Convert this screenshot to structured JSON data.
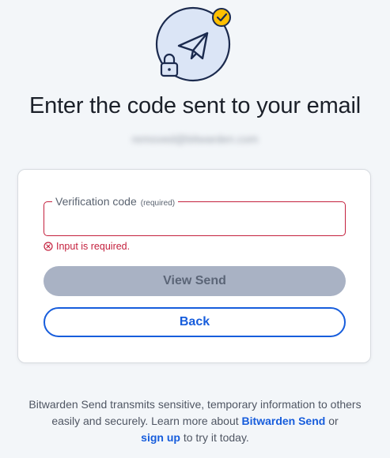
{
  "hero": {
    "main_icon": "paper-plane-icon",
    "badge_icon": "check-circle-icon",
    "lock_icon": "lock-icon",
    "colors": {
      "circle_fill": "#dbe5f6",
      "stroke": "#1b2a4e",
      "badge": "#ffbf00"
    }
  },
  "title": "Enter the code sent to your email",
  "email": "removed@bitwarden.com",
  "form": {
    "label": "Verification code",
    "required_hint": "(required)",
    "value": "",
    "error": "Input is required.",
    "error_icon": "error-circle-icon"
  },
  "buttons": {
    "view_send": "View Send",
    "back": "Back"
  },
  "footer": {
    "text1": "Bitwarden Send transmits sensitive, temporary information to others easily and securely. Learn more about ",
    "link1": "Bitwarden Send",
    "text2": " or ",
    "link2": "sign up",
    "text3": " to try it today."
  },
  "colors": {
    "brand": "#175ddc",
    "danger": "#c4213e",
    "disabled_button": "#a9b2c4"
  }
}
